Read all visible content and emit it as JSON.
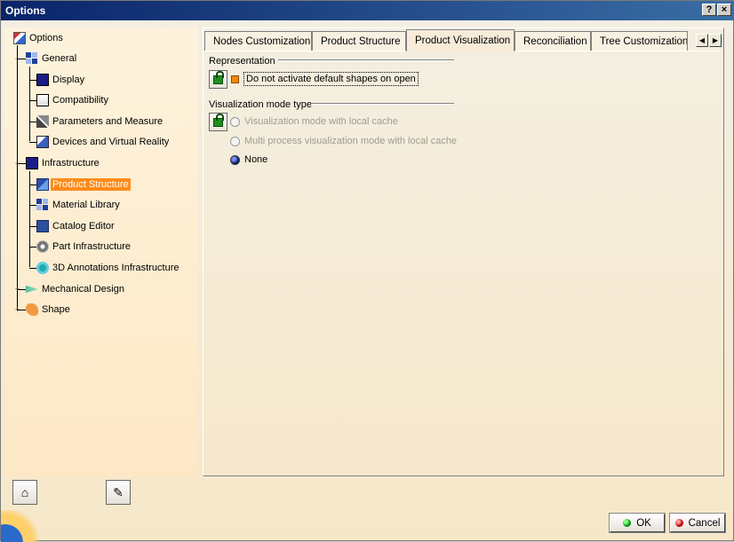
{
  "window": {
    "title": "Options",
    "help_label": "?",
    "close_label": "×"
  },
  "tree": {
    "root": "Options",
    "general": "General",
    "display": "Display",
    "compatibility": "Compatibility",
    "parameters": "Parameters and Measure",
    "devices": "Devices and Virtual Reality",
    "infrastructure": "Infrastructure",
    "product_structure": "Product Structure",
    "material_library": "Material Library",
    "catalog_editor": "Catalog Editor",
    "part_infrastructure": "Part Infrastructure",
    "annotations": "3D Annotations Infrastructure",
    "mechanical_design": "Mechanical Design",
    "shape": "Shape",
    "selected": "Product Structure"
  },
  "tabs": [
    {
      "label": "Nodes Customization"
    },
    {
      "label": "Product Structure"
    },
    {
      "label": "Product Visualization",
      "active": true
    },
    {
      "label": "Reconciliation"
    },
    {
      "label": "Tree Customization"
    }
  ],
  "tab_scroll": {
    "left": "◀",
    "right": "▶"
  },
  "representation": {
    "title": "Representation",
    "checkbox_label": "Do not activate default shapes on open",
    "checked": true
  },
  "visualization_mode": {
    "title": "Visualization mode type",
    "options": [
      {
        "label": "Visualization mode with local cache",
        "selected": false,
        "enabled": false
      },
      {
        "label": "Multi process visualization mode with local cache",
        "selected": false,
        "enabled": false
      },
      {
        "label": "None",
        "selected": true,
        "enabled": true
      }
    ]
  },
  "buttons": {
    "ok": "OK",
    "cancel": "Cancel"
  },
  "colors": {
    "selection": "#ff8c1a",
    "title_bar": "#0a246a"
  }
}
